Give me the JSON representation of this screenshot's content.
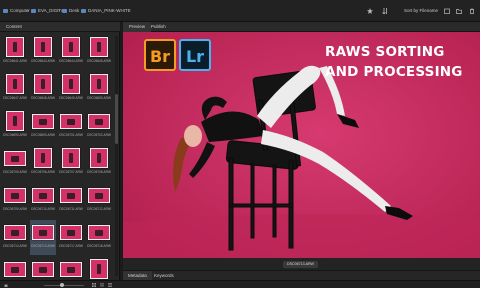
{
  "path": {
    "items": [
      "Computer",
      "EVA_DIGITAL",
      "Desk",
      "DANIA_PINK-WHITE"
    ]
  },
  "toolbar": {
    "sort_label": "Sort by Filename"
  },
  "content_panel": {
    "tab_label": "Content",
    "thumbnails": [
      "DSC06641.ARW",
      "DSC06643.ARW",
      "DSC06644.ARW",
      "DSC06646.ARW",
      "DSC06647.ARW",
      "DSC06648.ARW",
      "DSC06649.ARW",
      "DSC06650.ARW",
      "DSC06690.ARW",
      "DSC06690.ARW",
      "DSC06701.ARW",
      "DSC06702.ARW",
      "DSC06705.ARW",
      "DSC06706.ARW",
      "DSC06707.ARW",
      "DSC06708.ARW",
      "DSC06709.ARW",
      "DSC06710.ARW",
      "DSC06711.ARW",
      "DSC06712.ARW",
      "DSC06713.ARW",
      "DSC06713.ARW",
      "DSC06717.ARW",
      "DSC06718.ARW",
      "DSC06719.ARW",
      "DSC06720.ARW",
      "DSC06721.ARW",
      "DSC06722.ARW"
    ]
  },
  "preview": {
    "tabs": [
      "Preview",
      "Publish"
    ],
    "badges": [
      "Br",
      "Lr"
    ],
    "headline": [
      "RAWS SORTING",
      "AND PROCESSING"
    ],
    "filename": "DSC06713.ARW"
  },
  "metadata_tabs": [
    "Metadata",
    "Keywords"
  ],
  "colors": {
    "backdrop": "#c92a61",
    "bridge": "#f59b24",
    "lightroom": "#48b4ef"
  }
}
